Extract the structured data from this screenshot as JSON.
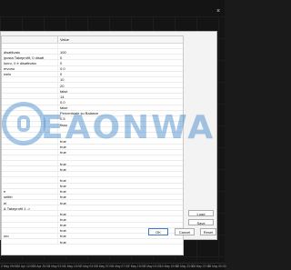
{
  "grid": {
    "header_variable": "",
    "header_value": "Value",
    "rows": [
      {
        "variable": "",
        "value": ""
      },
      {
        "variable": "disattivato",
        "value": "100"
      },
      {
        "variable": "iposta Takeprofit, 0 disatt",
        "value": "0"
      },
      {
        "variable": "lunro, 0 è disattivato",
        "value": "0"
      },
      {
        "variable": "ervono",
        "value": "0.0"
      },
      {
        "variable": "ivelo",
        "value": "0"
      },
      {
        "variable": "",
        "value": "10"
      },
      {
        "variable": "",
        "value": "20"
      },
      {
        "variable": "",
        "value": "false"
      },
      {
        "variable": "",
        "value": "14"
      },
      {
        "variable": "",
        "value": "0.0"
      },
      {
        "variable": "",
        "value": "false"
      },
      {
        "variable": "",
        "value": "Percentuale su Balance"
      },
      {
        "variable": "",
        "value": "0.5"
      },
      {
        "variable": "",
        "value": "fisso"
      },
      {
        "variable": "",
        "value": ""
      },
      {
        "variable": "",
        "value": ""
      },
      {
        "variable": "",
        "value": "true"
      },
      {
        "variable": "",
        "value": "true"
      },
      {
        "variable": "",
        "value": "true"
      },
      {
        "variable": "",
        "value": ""
      },
      {
        "variable": "",
        "value": "true"
      },
      {
        "variable": "",
        "value": "true"
      },
      {
        "variable": "",
        "value": ""
      },
      {
        "variable": "",
        "value": "true"
      },
      {
        "variable": "",
        "value": "true"
      },
      {
        "variable": "e",
        "value": "true"
      },
      {
        "variable": "settiri",
        "value": "true"
      },
      {
        "variable": "el",
        "value": "true"
      },
      {
        "variable": "& Takeprofit 1 ->",
        "value": ""
      },
      {
        "variable": "",
        "value": "true"
      },
      {
        "variable": "",
        "value": "true"
      },
      {
        "variable": "",
        "value": "true"
      },
      {
        "variable": "",
        "value": "true"
      },
      {
        "variable": "uto",
        "value": "true"
      },
      {
        "variable": "",
        "value": "true"
      }
    ]
  },
  "buttons": {
    "load": "Load",
    "save": "Save",
    "ok": "OK",
    "cancel": "Cancel",
    "reset": "Reset"
  },
  "watermark": "EAONWA",
  "time_axis": [
    "2 May 09:00",
    "30 Apr 12:00",
    "30 Apr 20:00",
    "1 May 03:00",
    "1 May 15:00",
    "2 May 03:00",
    "3 May 07:00",
    "4 May 07:00",
    "7 May 19:00",
    "8 May 03:00",
    "10 May 19:00",
    "12 May 23:00",
    "13 May 07:00",
    "15 May 00:00"
  ],
  "colors": {
    "accent": "#3b7ad4",
    "chart_background": "#141414",
    "dialog_background": "#f3f3f3"
  }
}
